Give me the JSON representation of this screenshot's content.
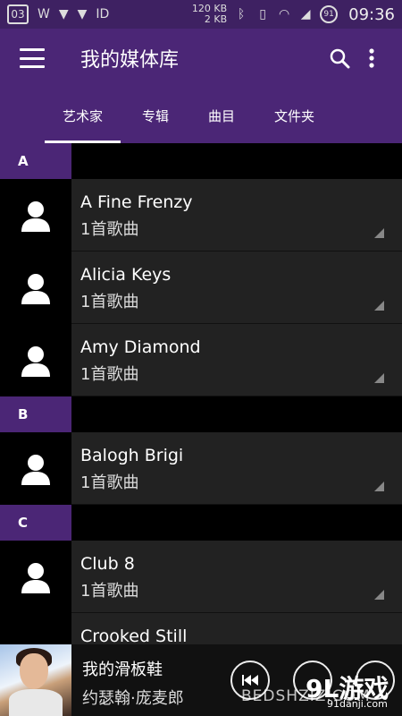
{
  "status_bar": {
    "badge": "03",
    "net_up": "120 KB",
    "net_down": "2 KB",
    "battery": "91",
    "time": "09:36"
  },
  "app_bar": {
    "title": "我的媒体库",
    "menu_icon": "hamburger-menu-icon",
    "search_icon": "search-icon",
    "more_icon": "more-vertical-icon"
  },
  "tabs": [
    {
      "label": "艺术家",
      "active": true
    },
    {
      "label": "专辑",
      "active": false
    },
    {
      "label": "曲目",
      "active": false
    },
    {
      "label": "文件夹",
      "active": false
    }
  ],
  "sections": [
    {
      "letter": "A",
      "artists": [
        {
          "name": "A Fine Frenzy",
          "count": "1首歌曲"
        },
        {
          "name": "Alicia Keys",
          "count": "1首歌曲"
        },
        {
          "name": "Amy Diamond",
          "count": "1首歌曲"
        }
      ]
    },
    {
      "letter": "B",
      "artists": [
        {
          "name": "Balogh Brigi",
          "count": "1首歌曲"
        }
      ]
    },
    {
      "letter": "C",
      "artists": [
        {
          "name": "Club 8",
          "count": "1首歌曲"
        },
        {
          "name": "Crooked Still",
          "count": ""
        }
      ]
    }
  ],
  "player": {
    "title": "我的滑板鞋",
    "artist": "约瑟翰·庞麦郎"
  },
  "watermark": {
    "site": "BEDSHZIZ.COM",
    "logo": "9L游戏",
    "url": "91danji.com"
  },
  "colors": {
    "status_bar": "#3e2162",
    "app_bar": "#4b2676",
    "row_bg": "#222222",
    "accent": "#4b2676"
  }
}
